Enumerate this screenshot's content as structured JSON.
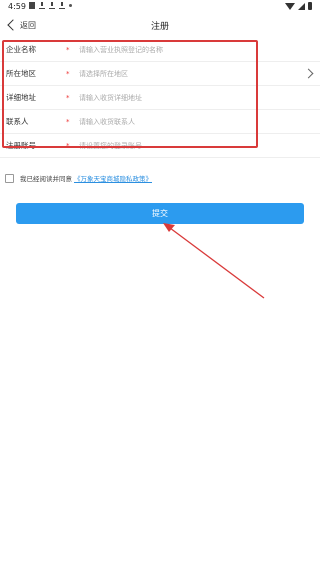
{
  "status_bar": {
    "time": "4:59"
  },
  "nav": {
    "back_label": "返回",
    "title": "注册"
  },
  "form": {
    "rows": [
      {
        "label": "企业名称",
        "required": "*",
        "placeholder": "请输入营业执照登记的名称",
        "has_chevron": false
      },
      {
        "label": "所在地区",
        "required": "*",
        "placeholder": "请选择所在地区",
        "has_chevron": true
      },
      {
        "label": "详细地址",
        "required": "*",
        "placeholder": "请输入收货详细地址",
        "has_chevron": false
      },
      {
        "label": "联系人",
        "required": "*",
        "placeholder": "请输入收货联系人",
        "has_chevron": false
      },
      {
        "label": "注册账号",
        "required": "*",
        "placeholder": "请设置您的登录账号",
        "has_chevron": false
      }
    ]
  },
  "agreement": {
    "text": "我已经阅读并同意",
    "link": "《万象天宝商城隐私政策》"
  },
  "submit": {
    "label": "提交"
  },
  "colors": {
    "accent": "#2c9bef",
    "annotation": "#d93a3a",
    "required": "#ee3333"
  }
}
